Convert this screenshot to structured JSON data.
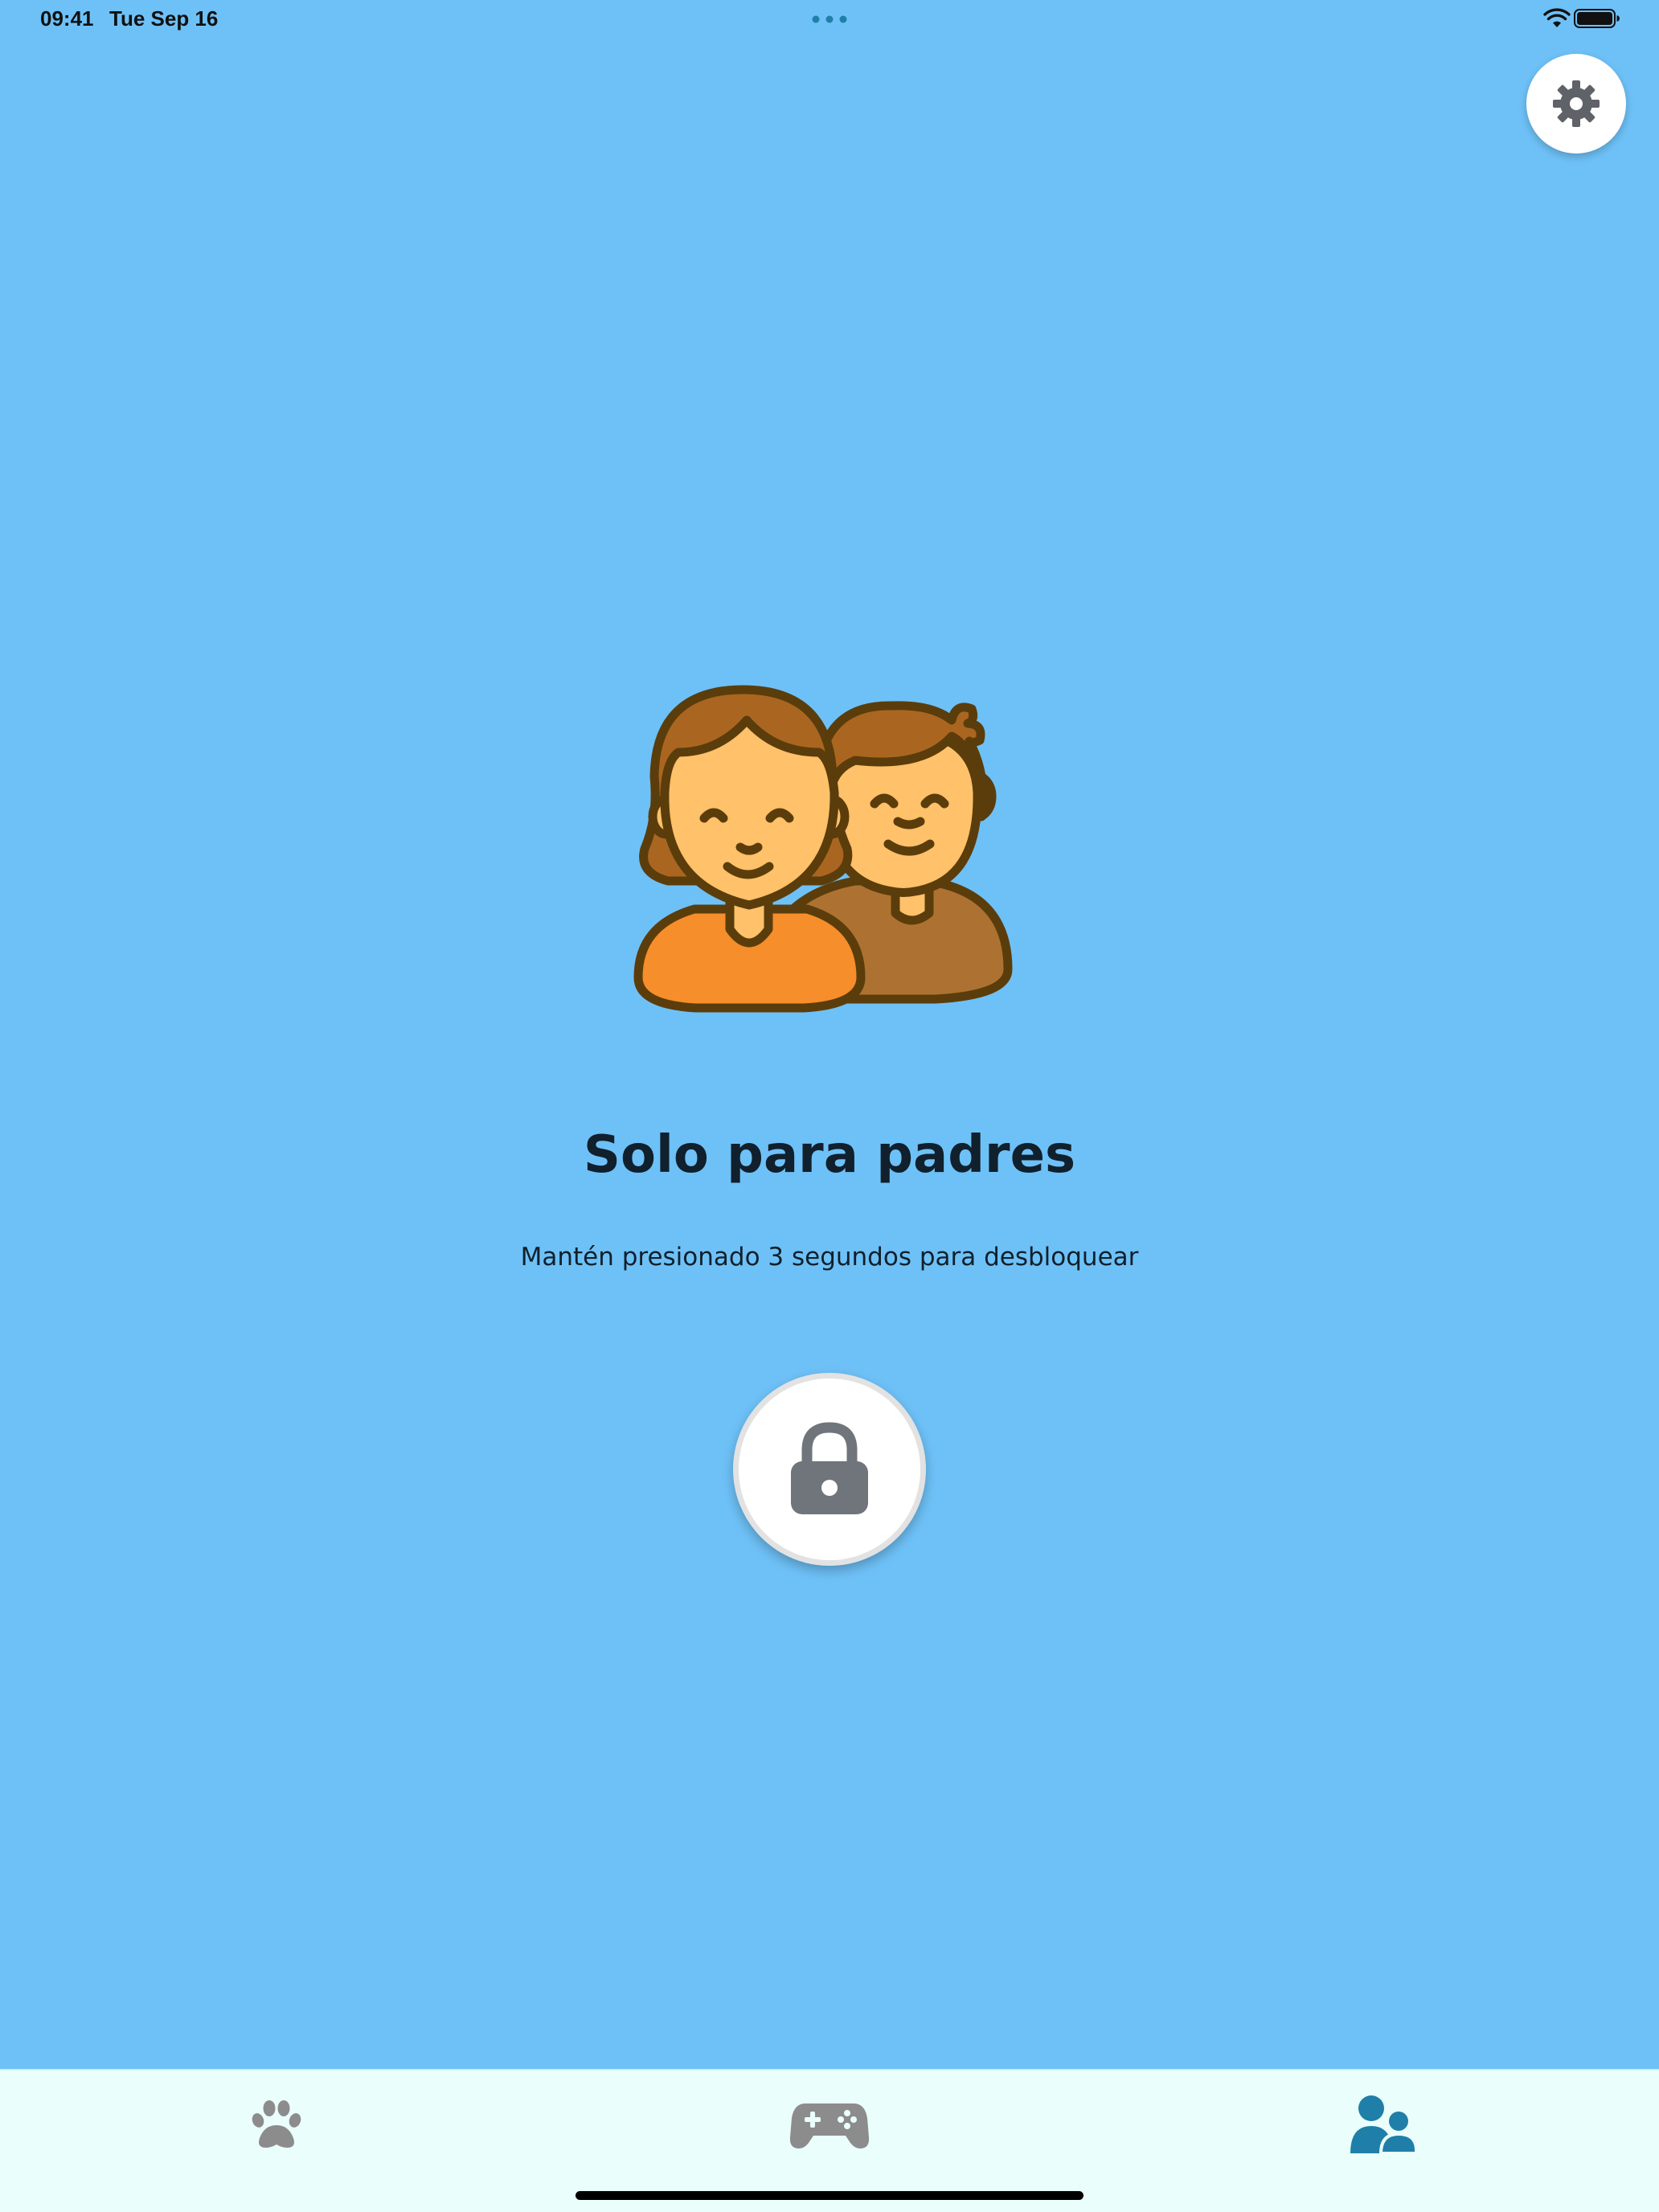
{
  "status_bar": {
    "time": "09:41",
    "date": "Tue Sep 16"
  },
  "main": {
    "title": "Solo para padres",
    "subtitle": "Mantén presionado 3 segundos para desbloquear"
  },
  "icons": {
    "settings": "gear-icon",
    "unlock": "lock-icon",
    "illustration": "parents-illustration",
    "tabs": [
      "paw-icon",
      "gamepad-icon",
      "parents-icon"
    ]
  },
  "tab_bar": {
    "active_tab": "parents",
    "tabs": [
      {
        "id": "pets",
        "icon": "paw-icon",
        "active": false
      },
      {
        "id": "games",
        "icon": "gamepad-icon",
        "active": false
      },
      {
        "id": "parents",
        "icon": "parents-icon",
        "active": true
      }
    ]
  },
  "colors": {
    "background": "#6ec1f7",
    "tab_bar_background": "#eafffc",
    "active_tab": "#1f7fa8",
    "inactive_tab": "#8c8c8c",
    "title_text": "#10202c",
    "lock_icon": "#6f757b"
  }
}
